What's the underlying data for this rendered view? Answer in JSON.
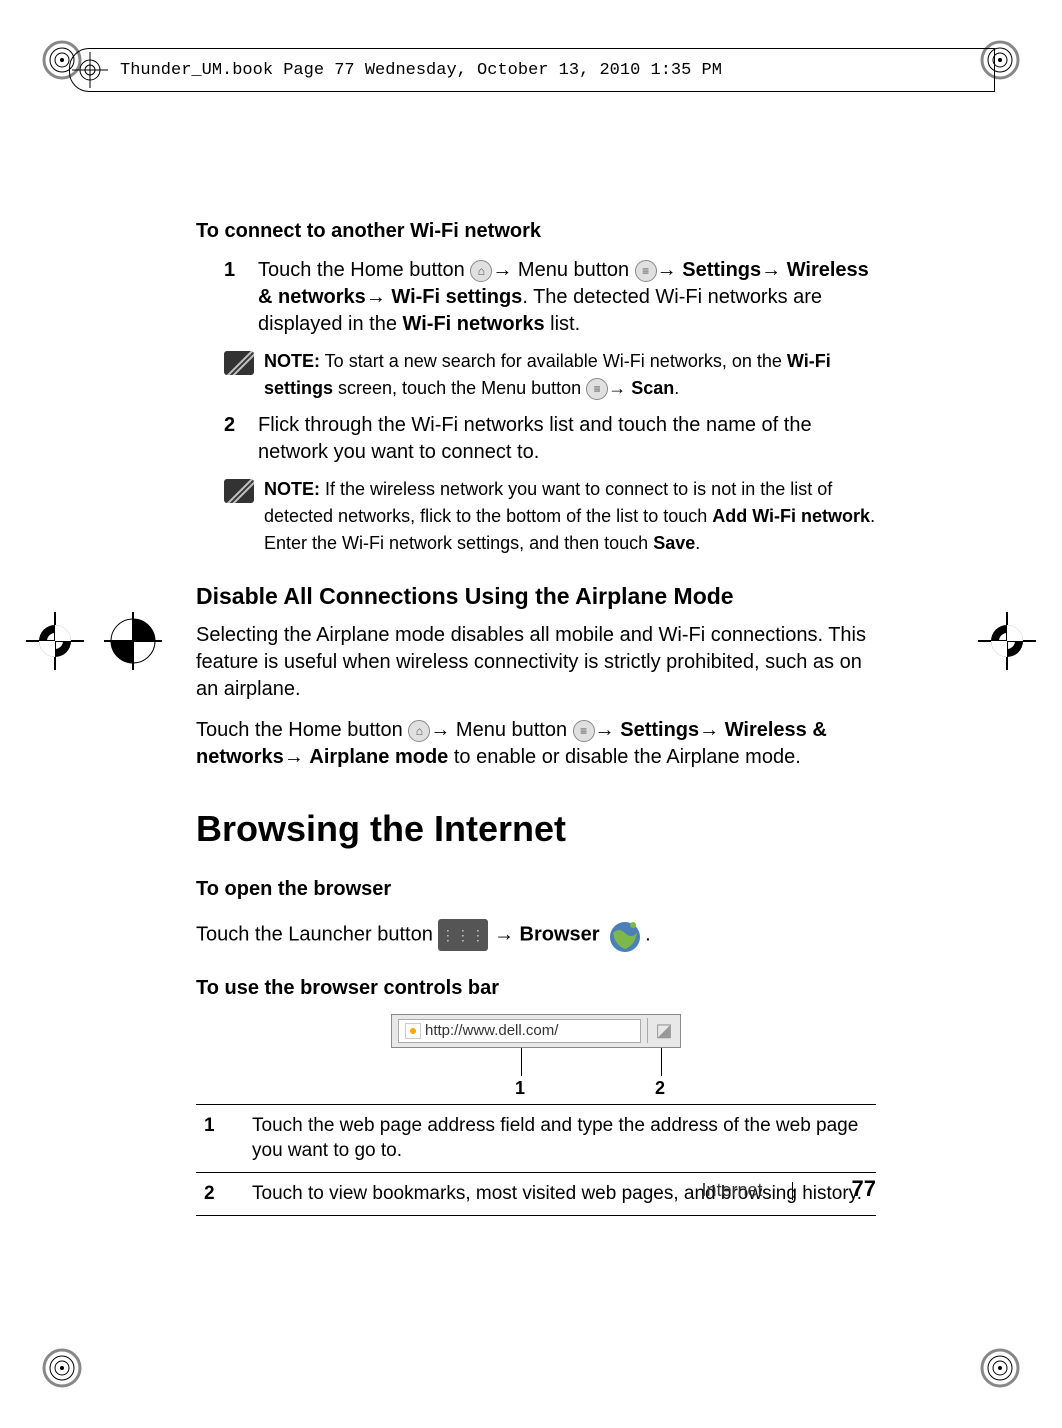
{
  "print_header": "Thunder_UM.book  Page 77  Wednesday, October 13, 2010  1:35 PM",
  "section_a": {
    "heading": "To connect to another Wi-Fi network",
    "step1_num": "1",
    "step1_pre": "Touch the Home button ",
    "step1_mid1": "→ Menu button ",
    "step1_b1": "Settings",
    "step1_b2": "Wireless & networks",
    "step1_b3": "Wi-Fi settings",
    "step1_txt1": ". The detected Wi-Fi networks are displayed in the ",
    "step1_b4": "Wi-Fi networks",
    "step1_txt2": " list.",
    "note1_b": "NOTE:",
    "note1_t1": " To start a new search for available Wi-Fi networks, on the ",
    "note1_b2": "Wi-Fi settings",
    "note1_t2": " screen, touch the Menu button ",
    "note1_b3": "Scan",
    "step2_num": "2",
    "step2_txt": "Flick through the Wi-Fi networks list and touch the name of the network you want to connect to.",
    "note2_b": "NOTE:",
    "note2_t1": " If the wireless network you want to connect to is not in the list of detected networks, flick to the bottom of the list to touch ",
    "note2_b2": "Add Wi-Fi network",
    "note2_t2": ". Enter the Wi-Fi network settings, and then touch ",
    "note2_b3": "Save"
  },
  "section_b": {
    "heading": "Disable All Connections Using the Airplane Mode",
    "p1": "Selecting the Airplane mode disables all mobile and Wi-Fi connections. This feature is useful when wireless connectivity is strictly prohibited, such as on an airplane.",
    "p2_pre": "Touch the Home button ",
    "p2_m1": "→ Menu button ",
    "p2_b1": "Settings",
    "p2_b2": "Wireless & networks",
    "p2_b3": "Airplane mode",
    "p2_end": " to enable or disable the Airplane mode."
  },
  "section_c": {
    "h1": "Browsing the Internet",
    "h_open": "To open the browser",
    "open_pre": "Touch the Launcher button ",
    "open_b": "Browser",
    "h_bar": "To use the browser controls bar",
    "url": "http://www.dell.com/",
    "cl1": "1",
    "cl2": "2",
    "t1n": "1",
    "t1": "Touch the web page address field and type the address of the web page you want to go to.",
    "t2n": "2",
    "t2": "Touch to view bookmarks, most visited web pages, and browsing history."
  },
  "footer": {
    "section": "Internet",
    "page": "77"
  }
}
